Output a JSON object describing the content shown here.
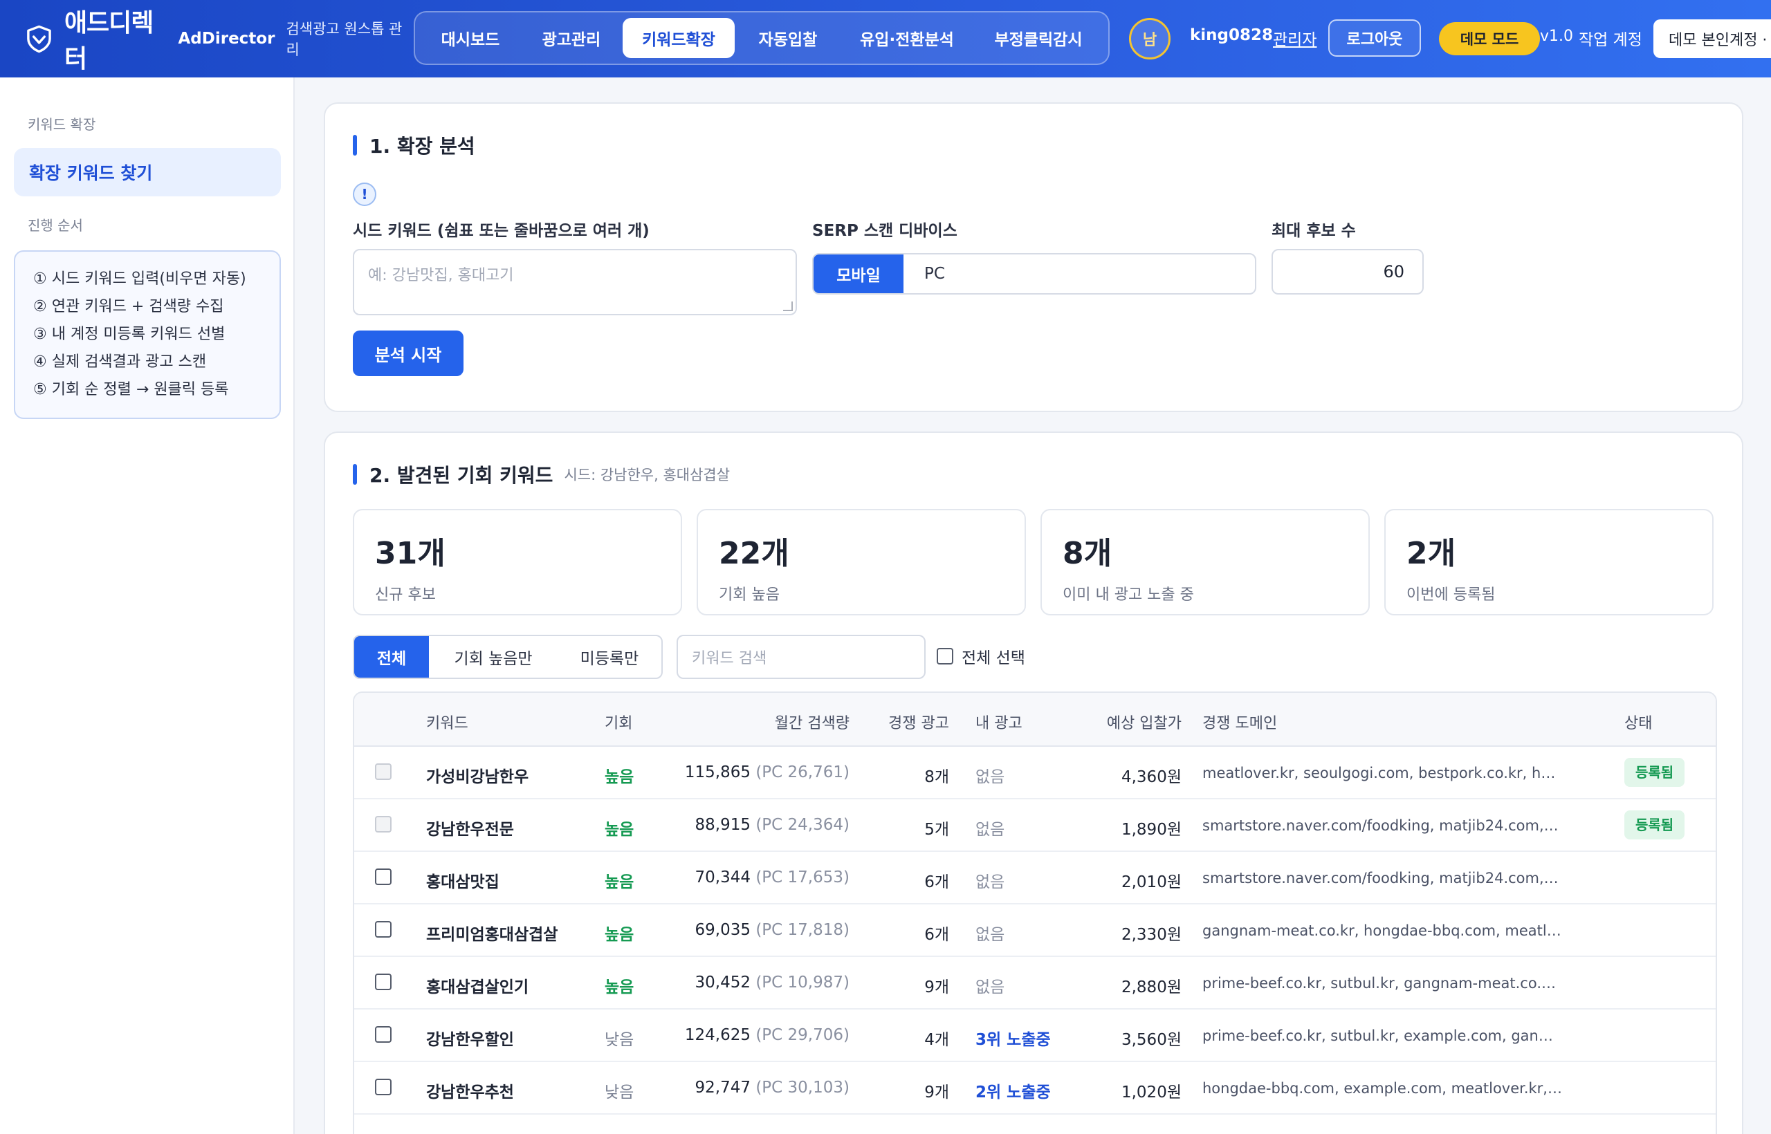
{
  "header": {
    "logo_title": "애드디렉터",
    "logo_en": "AdDirector",
    "logo_sub": "검색광고 원스톱 관리",
    "nav": [
      {
        "label": "대시보드"
      },
      {
        "label": "광고관리"
      },
      {
        "label": "키워드확장"
      },
      {
        "label": "자동입찰"
      },
      {
        "label": "유입·전환분석"
      },
      {
        "label": "부정클릭감시"
      }
    ],
    "active_nav": "키워드확장",
    "avatar_text": "남",
    "user_name": "king0828",
    "user_role": "관리자",
    "logout_label": "로그아웃",
    "demo_badge": "데모 모드",
    "version": "v1.0",
    "workspace_label": "작업 계정",
    "workspace_value": "데모 본인계정 ·"
  },
  "sidebar": {
    "section1": "키워드 확장",
    "active_item": "확장 키워드 찾기",
    "section2": "진행 순서",
    "steps": [
      "① 시드 키워드 입력(비우면 자동)",
      "② 연관 키워드 + 검색량 수집",
      "③ 내 계정 미등록 키워드 선별",
      "④ 실제 검색결과 광고 스캔",
      "⑤ 기회 순 정렬 → 원클릭 등록"
    ]
  },
  "analysis": {
    "title": "1. 확장 분석",
    "info_icon": "!",
    "seed_label": "시드 키워드 (쉼표 또는 줄바꿈으로 여러 개)",
    "seed_placeholder": "예: 강남맛집, 홍대고기",
    "device_label": "SERP 스캔 디바이스",
    "device_options": [
      "모바일",
      "PC"
    ],
    "max_label": "최대 후보 수",
    "max_value": "60",
    "start_button": "분석 시작"
  },
  "results": {
    "title": "2. 발견된 기회 키워드",
    "seed_info": "시드: 강남한우, 홍대삼겹살",
    "stats": [
      {
        "value": "31개",
        "label": "신규 후보"
      },
      {
        "value": "22개",
        "label": "기회 높음"
      },
      {
        "value": "8개",
        "label": "이미 내 광고 노출 중"
      },
      {
        "value": "2개",
        "label": "이번에 등록됨"
      }
    ],
    "filters": [
      "전체",
      "기회 높음만",
      "미등록만"
    ],
    "search_placeholder": "키워드 검색",
    "select_all_label": "전체 선택",
    "columns": {
      "keyword": "키워드",
      "opportunity": "기회",
      "volume": "월간 검색량",
      "competitors": "경쟁 광고",
      "my_ad": "내 광고",
      "bid": "예상 입찰가",
      "domains": "경쟁 도메인",
      "status": "상태"
    },
    "rows": [
      {
        "keyword": "가성비강남한우",
        "opportunity": "높음",
        "volume": "115,865",
        "pc": "(PC 26,761)",
        "competitors": "8개",
        "my_ad": "없음",
        "bid": "4,360원",
        "domains": "meatlover.kr, seoulgogi.com, bestpork.co.kr, hanwoo...",
        "status": "등록됨",
        "locked": true
      },
      {
        "keyword": "강남한우전문",
        "opportunity": "높음",
        "volume": "88,915",
        "pc": "(PC 24,364)",
        "competitors": "5개",
        "my_ad": "없음",
        "bid": "1,890원",
        "domains": "smartstore.naver.com/foodking, matjib24.com, gogi...",
        "status": "등록됨",
        "locked": true
      },
      {
        "keyword": "홍대삼맛집",
        "opportunity": "높음",
        "volume": "70,344",
        "pc": "(PC 17,653)",
        "competitors": "6개",
        "my_ad": "없음",
        "bid": "2,010원",
        "domains": "smartstore.naver.com/foodking, matjib24.com, gogi...",
        "status": "",
        "locked": false
      },
      {
        "keyword": "프리미엄홍대삼겹살",
        "opportunity": "높음",
        "volume": "69,035",
        "pc": "(PC 17,818)",
        "competitors": "6개",
        "my_ad": "없음",
        "bid": "2,330원",
        "domains": "gangnam-meat.co.kr, hongdae-bbq.com, meatlover....",
        "status": "",
        "locked": false
      },
      {
        "keyword": "홍대삼겹살인기",
        "opportunity": "높음",
        "volume": "30,452",
        "pc": "(PC 10,987)",
        "competitors": "9개",
        "my_ad": "없음",
        "bid": "2,880원",
        "domains": "prime-beef.co.kr, sutbul.kr, gangnam-meat.co.kr, ho...",
        "status": "",
        "locked": false
      },
      {
        "keyword": "강남한우할인",
        "opportunity": "낮음",
        "volume": "124,625",
        "pc": "(PC 29,706)",
        "competitors": "4개",
        "my_ad": "3위 노출중",
        "bid": "3,560원",
        "domains": "prime-beef.co.kr, sutbul.kr, example.com, gangnam-...",
        "status": "",
        "locked": false
      },
      {
        "keyword": "강남한우추천",
        "opportunity": "낮음",
        "volume": "92,747",
        "pc": "(PC 30,103)",
        "competitors": "9개",
        "my_ad": "2위 노출중",
        "bid": "1,020원",
        "domains": "hongdae-bbq.com, example.com, meatlover.kr, seou...",
        "status": "",
        "locked": false
      }
    ]
  },
  "colors": {
    "primary": "#2563eb",
    "header_start": "#1a46c4",
    "high": "#159a52",
    "demo": "#f7c51f"
  }
}
